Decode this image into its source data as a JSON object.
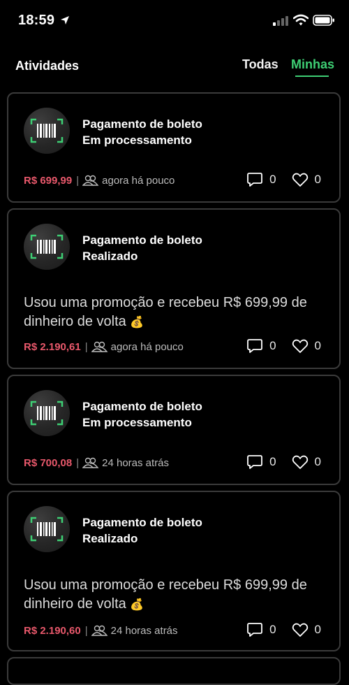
{
  "status_bar": {
    "time": "18:59"
  },
  "header": {
    "title": "Atividades",
    "tabs": [
      {
        "label": "Todas",
        "active": false
      },
      {
        "label": "Minhas",
        "active": true
      }
    ]
  },
  "colors": {
    "accent": "#3ecf74",
    "amount": "#e8586b",
    "card_border": "#3b3b3b"
  },
  "cards": [
    {
      "title": "Pagamento de boleto",
      "status": "Em processamento",
      "description": "",
      "amount": "R$ 699,99",
      "time": "agora há pouco",
      "comments": "0",
      "likes": "0"
    },
    {
      "title": "Pagamento de boleto",
      "status": "Realizado",
      "description": "Usou uma promoção e recebeu R$ 699,99 de dinheiro de volta",
      "emoji": "💰",
      "amount": "R$ 2.190,61",
      "time": "agora há pouco",
      "comments": "0",
      "likes": "0"
    },
    {
      "title": "Pagamento de boleto",
      "status": "Em processamento",
      "description": "",
      "amount": "R$ 700,08",
      "time": "24 horas atrás",
      "comments": "0",
      "likes": "0"
    },
    {
      "title": "Pagamento de boleto",
      "status": "Realizado",
      "description": "Usou uma promoção e recebeu R$ 699,99 de dinheiro de volta",
      "emoji": "💰",
      "amount": "R$ 2.190,60",
      "time": "24 horas atrás",
      "comments": "0",
      "likes": "0"
    }
  ]
}
